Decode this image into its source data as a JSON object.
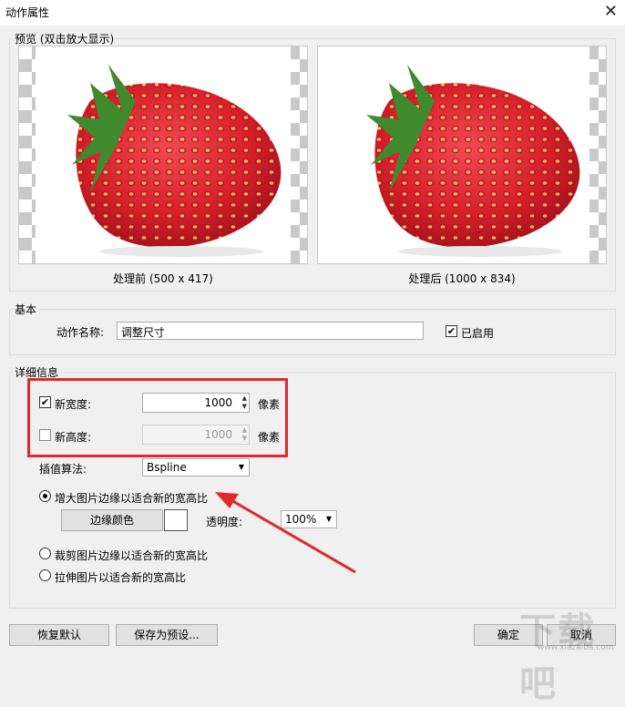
{
  "window": {
    "title": "动作属性",
    "close_icon": "close-icon"
  },
  "preview": {
    "legend": "预览 (双击放大显示)",
    "before_caption": "处理前 (500 x 417)",
    "after_caption": "处理后 (1000 x 834)"
  },
  "basic": {
    "legend": "基本",
    "action_name_label": "动作名称:",
    "action_name_value": "调整尺寸",
    "enabled_label": "已启用",
    "enabled_checked": true
  },
  "details": {
    "legend": "详细信息",
    "new_width_label": "新宽度:",
    "new_width_checked": true,
    "new_width_value": "1000",
    "new_width_unit": "像素",
    "new_height_label": "新高度:",
    "new_height_checked": false,
    "new_height_value": "1000",
    "new_height_unit": "像素",
    "interp_label": "插值算法:",
    "interp_value": "Bspline",
    "option_enlarge": "增大图片边缘以适合新的宽高比",
    "border_color_button": "边缘颜色",
    "transparency_label": "透明度:",
    "transparency_value": "100%",
    "option_crop": "裁剪图片边缘以适合新的宽高比",
    "option_stretch": "拉伸图片以适合新的宽高比"
  },
  "footer": {
    "restore_default": "恢复默认",
    "save_preset": "保存为预设...",
    "ok": "确定",
    "cancel": "取消"
  },
  "watermark": {
    "text": "下载吧",
    "sub": "www.xiazaiba.com"
  },
  "colors": {
    "highlight": "#e0282e",
    "strawberry": "#e0242e",
    "leaf": "#3f8a2e"
  }
}
